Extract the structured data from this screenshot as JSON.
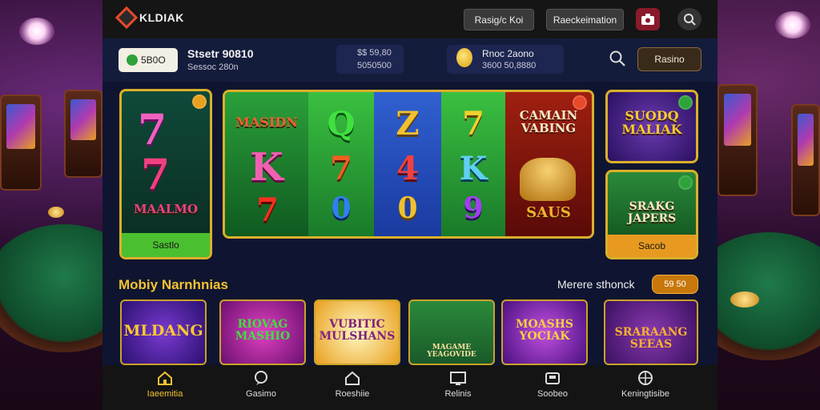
{
  "colors": {
    "accent": "#f2c230",
    "gold_border": "#d9b02a",
    "topbar": "#151515",
    "app_bg": "#0f1530"
  },
  "header": {
    "logo_text": "KLDIAK",
    "button_1": "Rasig/c Koi",
    "button_2": "Raeckeimation",
    "icons": [
      "camera-icon",
      "search-icon"
    ]
  },
  "status": {
    "balance": "5B0O",
    "title": "Stsetr 90810",
    "subtitle": "Sessoc 280n",
    "mid_1": "$$ 59,80",
    "mid_2": "5050500",
    "right_1": "Rnoc 2aono",
    "right_2": "3600 50,8880",
    "cta": "Rasino"
  },
  "featured": {
    "left_tile": {
      "title": "MAALMO",
      "cta": "Sastlo"
    },
    "reels_tile": {
      "title": "MASIDN",
      "side_title": "CAMAIN VABING",
      "side_bottom": "SAUS"
    },
    "right_top": {
      "title": "SUODQ MALIAK"
    },
    "right_bottom": {
      "title": "SRAKG JAPERS",
      "cta": "Sacob"
    }
  },
  "section": {
    "title": "Mobiy Narnhnias",
    "see_more": "Merere sthonck",
    "see_more_btn": "59 50"
  },
  "cards": [
    {
      "title": "MLDANG"
    },
    {
      "title": "RIOVAG MASHIO"
    },
    {
      "title": "VUBITIC MULSHANS"
    },
    {
      "title": "MAGAME YEAGOVIDE"
    },
    {
      "title": "MOASHS YOCIAK"
    },
    {
      "title": "SRARAANG SEEAS"
    }
  ],
  "nav": [
    {
      "label": "Iaeemitia",
      "icon": "home-icon"
    },
    {
      "label": "Gasimo",
      "icon": "chat-icon"
    },
    {
      "label": "Roeshiie",
      "icon": "house-icon"
    },
    {
      "label": "Relinis",
      "icon": "screen-icon"
    },
    {
      "label": "Soobeo",
      "icon": "wallet-icon"
    },
    {
      "label": "Keningtisibe",
      "icon": "ball-icon"
    }
  ]
}
